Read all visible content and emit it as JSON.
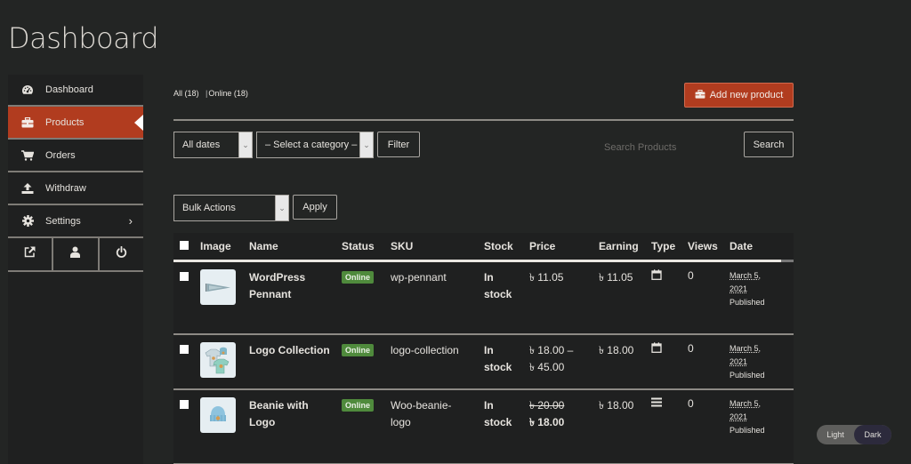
{
  "page": {
    "title": "Dashboard"
  },
  "sidebar": {
    "items": [
      {
        "label": "Dashboard",
        "icon": "dashboard-gauge-icon",
        "active": false
      },
      {
        "label": "Products",
        "icon": "briefcase-icon",
        "active": true
      },
      {
        "label": "Orders",
        "icon": "cart-icon",
        "active": false
      },
      {
        "label": "Withdraw",
        "icon": "upload-icon",
        "active": false
      },
      {
        "label": "Settings",
        "icon": "gear-icon",
        "active": false,
        "chevron": "›"
      }
    ],
    "bottom": [
      {
        "icon": "external-link-icon"
      },
      {
        "icon": "user-icon"
      },
      {
        "icon": "power-icon"
      }
    ]
  },
  "filters": {
    "all_label": "All (18)",
    "separator": "|",
    "online_label": "Online (18)",
    "add_new_label": "Add new product",
    "dates_select": "All dates",
    "category_select": "– Select a category –",
    "filter_button": "Filter",
    "search_placeholder": "Search Products",
    "search_value": "",
    "search_button": "Search",
    "bulk_select": "Bulk Actions",
    "apply_button": "Apply"
  },
  "table": {
    "headers": [
      "Image",
      "Name",
      "Status",
      "SKU",
      "Stock",
      "Price",
      "Earning",
      "Type",
      "Views",
      "Date"
    ],
    "rows": [
      {
        "name_line1": "WordPress",
        "name_line2": "Pennant",
        "status": "Online",
        "sku_line1": "wp-pennant",
        "sku_line2": "",
        "stock_line1": "In",
        "stock_line2": "stock",
        "price_line1": "৳ 11.05",
        "price_line2": "",
        "earning": "৳ 11.05",
        "type_icon": "calendar-icon",
        "views": "0",
        "date_line1": "March 5,",
        "date_line2": "2021",
        "date_status": "Published",
        "thumb": "pennant"
      },
      {
        "name_line1": "Logo Collection",
        "name_line2": "",
        "status": "Online",
        "sku_line1": "logo-collection",
        "sku_line2": "",
        "stock_line1": "In",
        "stock_line2": "stock",
        "price_line1": "৳ 18.00 –",
        "price_line2": "৳ 45.00",
        "earning": "৳ 18.00",
        "type_icon": "calendar-icon",
        "views": "0",
        "date_line1": "March 5,",
        "date_line2": "2021",
        "date_status": "Published",
        "thumb": "collection"
      },
      {
        "name_line1": "Beanie with",
        "name_line2": "Logo",
        "status": "Online",
        "sku_line1": "Woo-beanie-",
        "sku_line2": "logo",
        "stock_line1": "In",
        "stock_line2": "stock",
        "price_regular": "৳ 20.00",
        "price_sale": "৳ 18.00",
        "earning": "৳ 18.00",
        "type_icon": "list-icon",
        "views": "0",
        "date_line1": "March 5,",
        "date_line2": "2021",
        "date_status": "Published",
        "thumb": "beanie"
      }
    ]
  },
  "theme_toggle": {
    "light_label": "Light",
    "dark_label": "Dark",
    "selected": "Dark"
  },
  "colors": {
    "accent": "#b13c1f",
    "online_badge": "#4f8a3c",
    "background": "#232524"
  }
}
